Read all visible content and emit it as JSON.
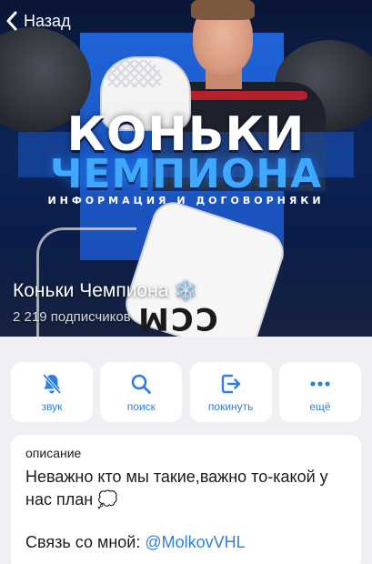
{
  "nav": {
    "back_label": "Назад"
  },
  "cover": {
    "title_line1": "КОНЬКИ",
    "title_line2": "ЧЕМПИОНА",
    "subtitle": "ИНФОРМАЦИЯ И ДОГОВОРНЯКИ",
    "pad_brand": "CCM"
  },
  "channel": {
    "name": "Коньки Чемпиона",
    "name_emoji": "❄️",
    "subscribers": "2 219 подписчиков"
  },
  "actions": [
    {
      "label": "звук",
      "icon": "bell-mute-icon"
    },
    {
      "label": "поиск",
      "icon": "search-icon"
    },
    {
      "label": "покинуть",
      "icon": "leave-icon"
    },
    {
      "label": "ещё",
      "icon": "more-icon"
    }
  ],
  "description": {
    "header": "описание",
    "text": "Неважно кто мы такие,важно то-какой у нас план 💭",
    "contact_prefix": "Связь со мной: ",
    "contact_link": "@MolkovVHL"
  },
  "colors": {
    "accent": "#2f7fe0",
    "background": "#efeff4",
    "cover_blue": "#1f63d8"
  }
}
